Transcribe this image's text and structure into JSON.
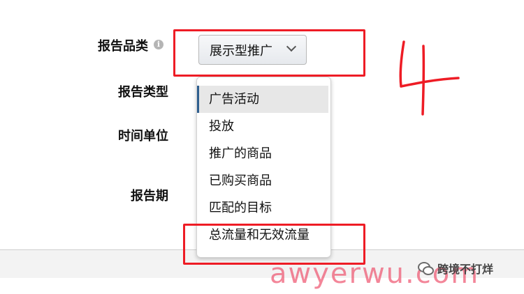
{
  "form": {
    "category_label": "报告品类",
    "type_label": "报告类型",
    "unit_label": "时间单位",
    "period_label": "报告期",
    "info_icon": "i"
  },
  "category_select": {
    "value": "展示型推广",
    "icon": "chevron-down-icon"
  },
  "dropdown": {
    "options": [
      {
        "label": "广告活动",
        "selected": true
      },
      {
        "label": "投放",
        "selected": false
      },
      {
        "label": "推广的商品",
        "selected": false
      },
      {
        "label": "已购买商品",
        "selected": false
      },
      {
        "label": "匹配的目标",
        "selected": false
      },
      {
        "label": "总流量和无效流量",
        "selected": false
      }
    ]
  },
  "annotation": {
    "color": "#ee1c25"
  },
  "watermark": {
    "text": "awyerwu.com",
    "wechat_name": "跨境不打烊"
  }
}
